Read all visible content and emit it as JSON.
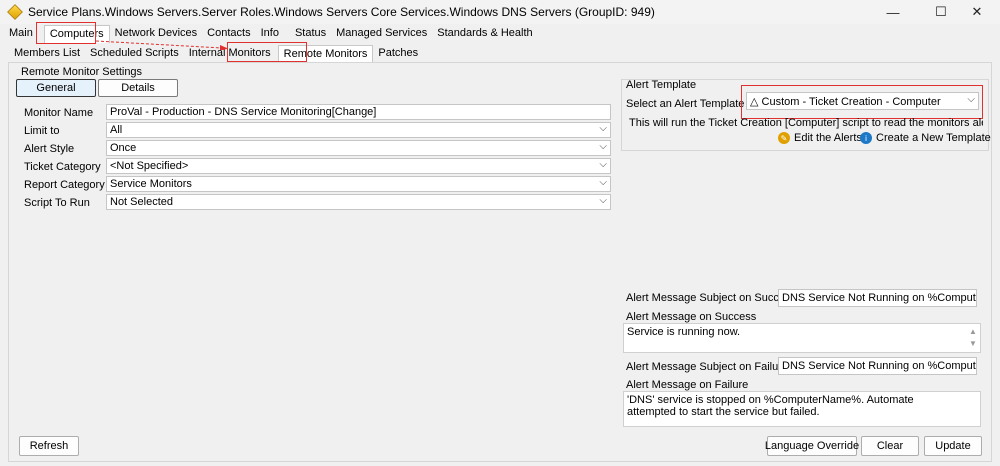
{
  "window": {
    "title": "Service Plans.Windows Servers.Server Roles.Windows Servers Core Services.Windows DNS Servers    (GroupID: 949)",
    "minimize": "—",
    "maximize": "☐",
    "close": "✕"
  },
  "main_tabs": [
    "Main",
    "Computers",
    "Network Devices",
    "Contacts",
    "Info",
    "Status",
    "Managed Services",
    "Standards & Health"
  ],
  "sub_tabs": [
    "Members List",
    "Scheduled Scripts",
    "Internal Monitors",
    "Remote Monitors",
    "Patches"
  ],
  "settings": {
    "group_title": "Remote Monitor Settings",
    "toggle_general": "General",
    "toggle_details": "Details",
    "monitor_name_label": "Monitor Name",
    "monitor_name_value": "ProVal - Production - DNS Service Monitoring[Change]",
    "limit_to_label": "Limit to",
    "limit_to_value": "All",
    "alert_style_label": "Alert Style",
    "alert_style_value": "Once",
    "ticket_category_label": "Ticket Category",
    "ticket_category_value": "<Not Specified>",
    "report_category_label": "Report Category",
    "report_category_value": "Service Monitors",
    "script_label": "Script To Run",
    "script_value": "Not Selected"
  },
  "alert_template": {
    "group_title": "Alert Template",
    "select_label": "Select an Alert Template",
    "selected_value": "△ Custom - Ticket Creation - Computer",
    "description": "This will run the Ticket Creation [Computer] script to read the monitors alerting inform...",
    "edit_alerts": "Edit the Alerts",
    "create_template": "Create a New Template"
  },
  "messages": {
    "success_subject_label": "Alert Message Subject on Success:",
    "success_subject_value": "DNS Service Not Running on %ComputerName%",
    "success_message_label": "Alert Message on Success",
    "success_message_value": "Service is running now.",
    "failure_subject_label": "Alert Message Subject on Failure:",
    "failure_subject_value": "DNS Service Not Running on %ComputerName%",
    "failure_message_label": "Alert Message on Failure",
    "failure_message_value": "'DNS' service is stopped on %ComputerName%. Automate attempted to start the service but failed."
  },
  "footer": {
    "refresh": "Refresh",
    "language_override": "Language Override",
    "clear": "Clear",
    "update": "Update"
  },
  "colors": {
    "highlight_red": "#e0312f",
    "info_blue": "#1e78c8"
  }
}
